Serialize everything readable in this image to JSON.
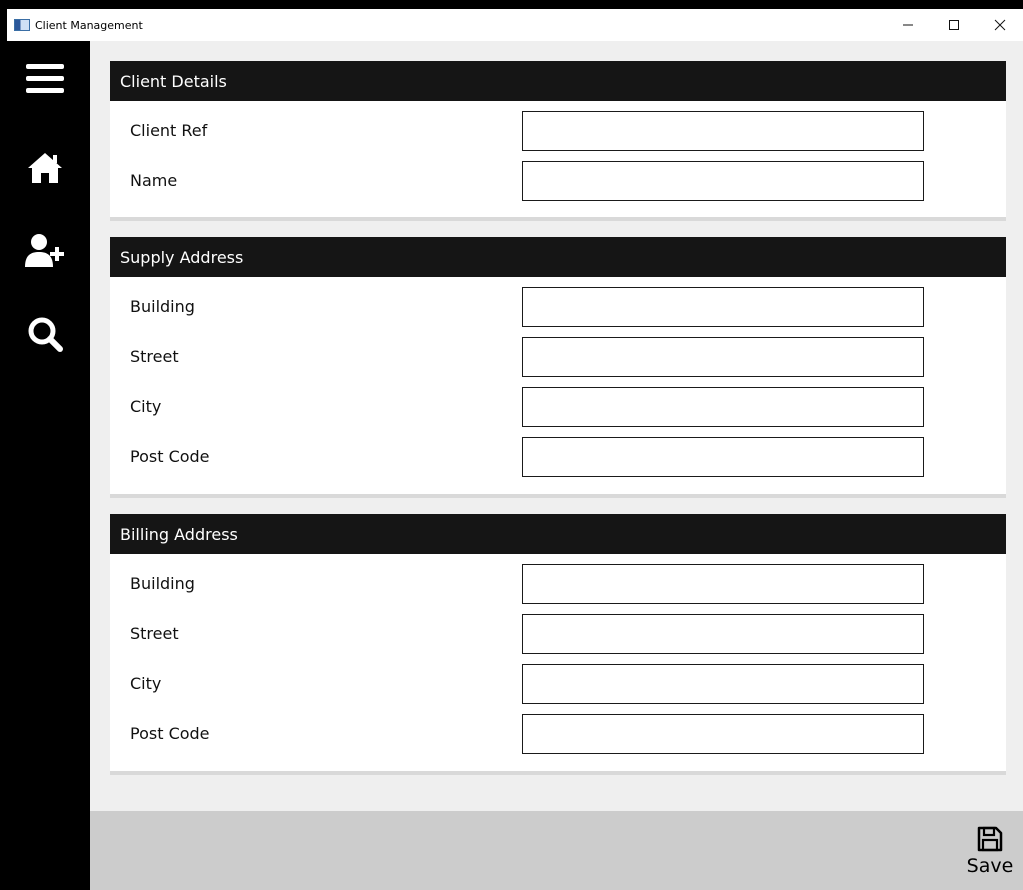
{
  "window": {
    "title": "Client Management",
    "controls": {
      "minimize": "–",
      "maximize": "☐",
      "close": "✕"
    }
  },
  "sidebar": {
    "items": [
      {
        "icon": "hamburger-menu-icon"
      },
      {
        "icon": "home-icon"
      },
      {
        "icon": "add-user-icon"
      },
      {
        "icon": "search-icon"
      }
    ]
  },
  "sections": {
    "client_details": {
      "title": "Client Details",
      "fields": [
        {
          "label": "Client Ref",
          "value": ""
        },
        {
          "label": "Name",
          "value": ""
        }
      ]
    },
    "supply_address": {
      "title": "Supply Address",
      "fields": [
        {
          "label": "Building",
          "value": ""
        },
        {
          "label": "Street",
          "value": ""
        },
        {
          "label": "City",
          "value": ""
        },
        {
          "label": "Post Code",
          "value": ""
        }
      ]
    },
    "billing_address": {
      "title": "Billing Address",
      "fields": [
        {
          "label": "Building",
          "value": ""
        },
        {
          "label": "Street",
          "value": ""
        },
        {
          "label": "City",
          "value": ""
        },
        {
          "label": "Post Code",
          "value": ""
        }
      ]
    }
  },
  "footer": {
    "save_label": "Save",
    "save_icon": "floppy-disk-icon"
  },
  "colors": {
    "sidebar": "#000000",
    "section_header": "#151515",
    "background": "#efefef",
    "footer": "#cccccc"
  }
}
